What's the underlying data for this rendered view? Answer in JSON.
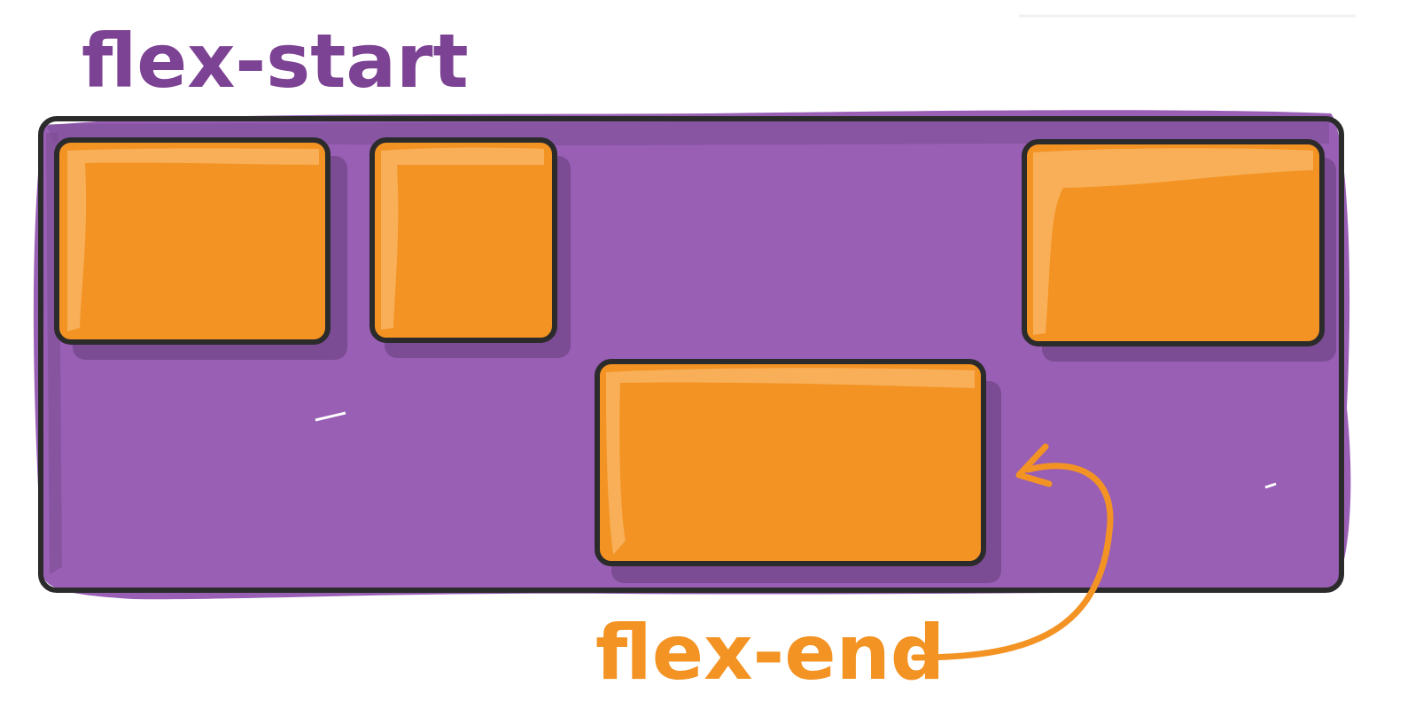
{
  "title_label": "flex-start",
  "callout_label": "flex-end",
  "colors": {
    "container_fill": "#985FB5",
    "container_shadow": "#7B4C93",
    "item_fill": "#F39323",
    "item_highlight": "#F8AF58",
    "outline": "#2B2B2B",
    "title_text": "#7C4293",
    "callout_text": "#F39323",
    "arrow": "#F39323"
  },
  "container": {
    "align_items": "flex-start",
    "item_count": 4
  },
  "items": [
    {
      "name": "item-1",
      "align_self": "flex-start"
    },
    {
      "name": "item-2",
      "align_self": "flex-start"
    },
    {
      "name": "item-3",
      "align_self": "flex-end"
    },
    {
      "name": "item-4",
      "align_self": "flex-start"
    }
  ]
}
